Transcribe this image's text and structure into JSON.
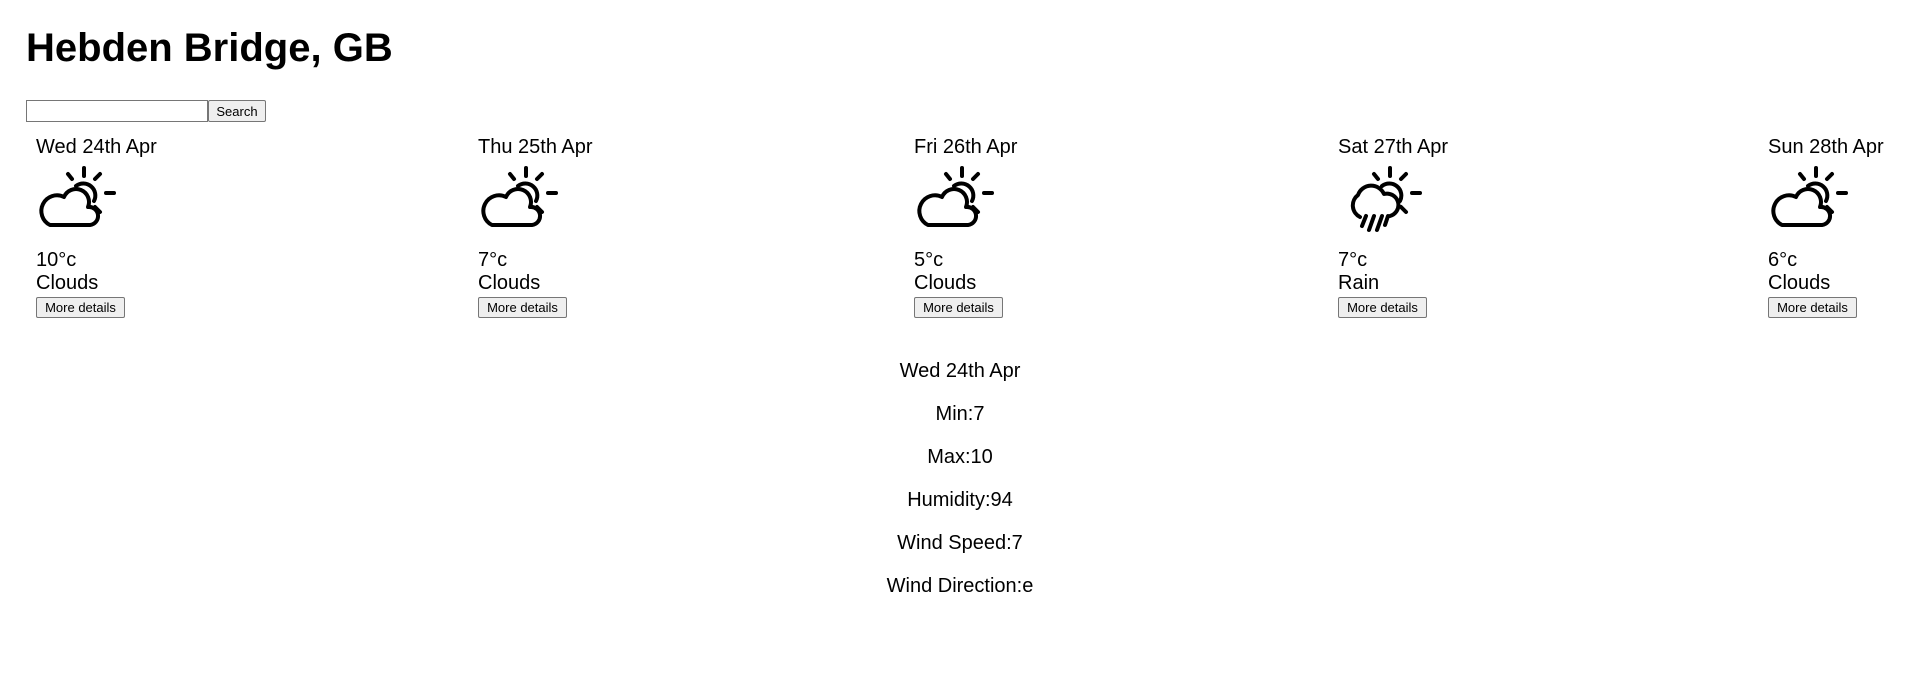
{
  "header": {
    "title": "Hebden Bridge, GB"
  },
  "search": {
    "value": "",
    "placeholder": "",
    "button_label": "Search"
  },
  "forecast": [
    {
      "date": "Wed 24th Apr",
      "temp": "10°c",
      "description": "Clouds",
      "icon": "partly-cloudy-icon",
      "button_label": "More details"
    },
    {
      "date": "Thu 25th Apr",
      "temp": "7°c",
      "description": "Clouds",
      "icon": "partly-cloudy-icon",
      "button_label": "More details"
    },
    {
      "date": "Fri 26th Apr",
      "temp": "5°c",
      "description": "Clouds",
      "icon": "partly-cloudy-icon",
      "button_label": "More details"
    },
    {
      "date": "Sat 27th Apr",
      "temp": "7°c",
      "description": "Rain",
      "icon": "sun-cloud-rain-icon",
      "button_label": "More details"
    },
    {
      "date": "Sun 28th Apr",
      "temp": "6°c",
      "description": "Clouds",
      "icon": "partly-cloudy-icon",
      "button_label": "More details"
    }
  ],
  "details": {
    "date": "Wed 24th Apr",
    "min": "Min:7",
    "max": "Max:10",
    "humidity": "Humidity:94",
    "wind_speed": "Wind Speed:7",
    "wind_direction": "Wind Direction:e"
  }
}
